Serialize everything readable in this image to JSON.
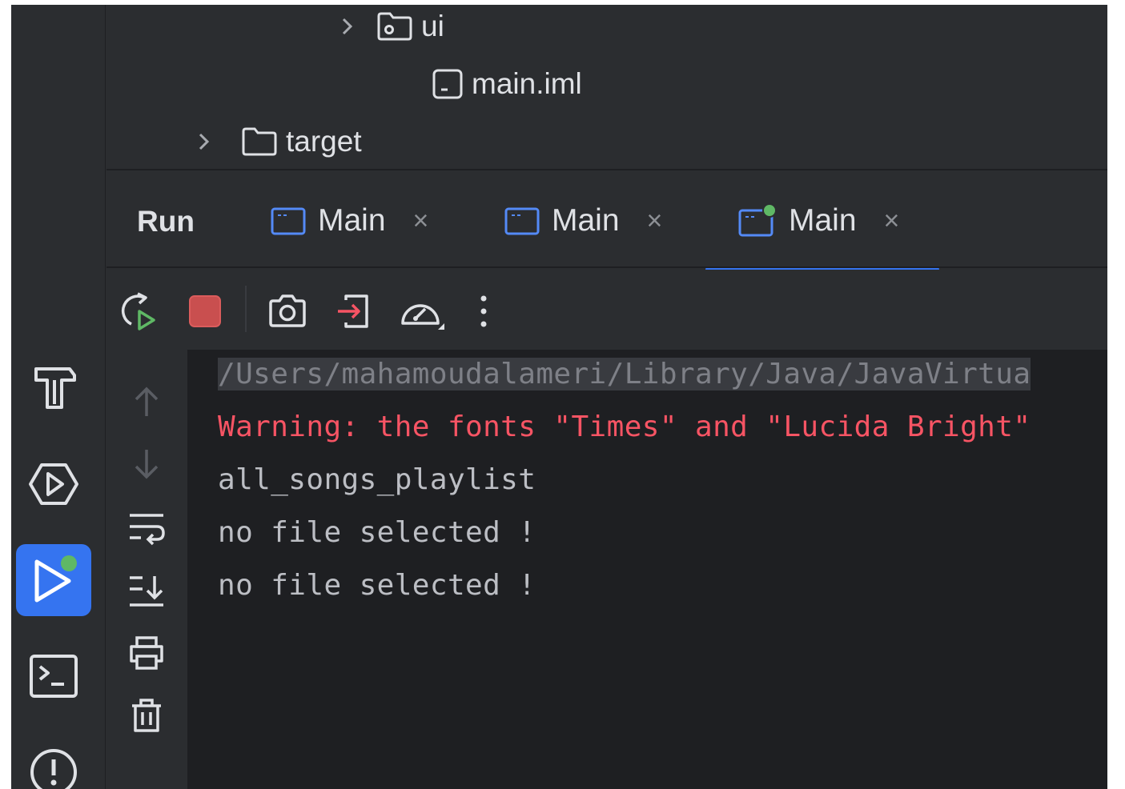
{
  "project_tree": {
    "items": [
      {
        "label": "ui",
        "icon": "package-folder-icon",
        "expandable": true
      },
      {
        "label": "main.iml",
        "icon": "module-file-icon",
        "expandable": false
      },
      {
        "label": "target",
        "icon": "folder-icon",
        "expandable": true
      }
    ]
  },
  "run_panel": {
    "title": "Run",
    "tabs": [
      {
        "label": "Main",
        "close": "×",
        "active": false,
        "running": false
      },
      {
        "label": "Main",
        "close": "×",
        "active": false,
        "running": false
      },
      {
        "label": "Main",
        "close": "×",
        "active": true,
        "running": true
      }
    ]
  },
  "toolbar": {
    "buttons": [
      "rerun-icon",
      "stop-icon",
      "screenshot-icon",
      "exit-icon",
      "profiler-icon",
      "more-icon"
    ]
  },
  "console_gutter": {
    "buttons": [
      "up-arrow-icon",
      "down-arrow-icon",
      "soft-wrap-icon",
      "scroll-to-end-icon",
      "print-icon",
      "trash-icon"
    ]
  },
  "console": {
    "lines": [
      "/Users/mahamoudalameri/Library/Java/JavaVirtua",
      "Warning: the fonts \"Times\" and \"Lucida Bright\"",
      "all_songs_playlist",
      "no file selected !",
      "no file selected !"
    ]
  },
  "activity_bar": {
    "buttons": [
      "build-icon",
      "services-icon",
      "run-icon",
      "terminal-icon",
      "problems-icon"
    ]
  },
  "colors": {
    "accent": "#3574f0",
    "error_text": "#f75464",
    "running_dot": "#5fb865",
    "stop_red": "#c94f4f"
  }
}
